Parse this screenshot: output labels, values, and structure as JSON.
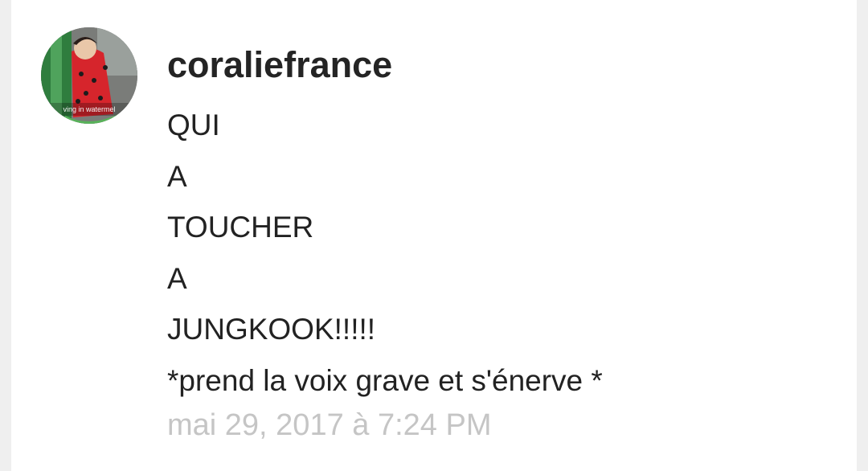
{
  "comment": {
    "username": "coraliefrance",
    "avatar": {
      "caption": "ving in watermel",
      "icon": "watermelon-costume-photo"
    },
    "lines": [
      "QUI",
      "A",
      "TOUCHER",
      "A",
      "JUNGKOOK!!!!!",
      "*prend la voix grave et s'énerve *"
    ],
    "timestamp": "mai 29, 2017 à 7:24 PM"
  }
}
